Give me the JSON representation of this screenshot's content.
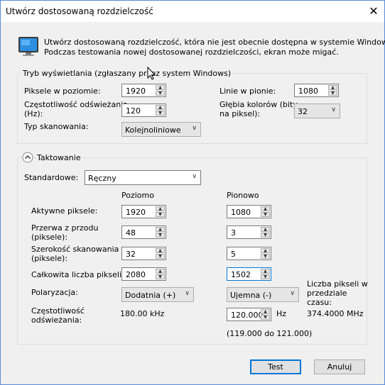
{
  "dialog": {
    "title": "Utwórz dostosowaną rozdzielczość",
    "close_glyph": "✕",
    "description_line1": "Utwórz dostosowaną rozdzielczość, która nie jest obecnie dostępna w systemie Windows.",
    "description_line2": "Podczas testowania nowej dostosowanej rozdzielczości, ekran może migać."
  },
  "display_mode": {
    "legend": "Tryb wyświetlania (zgłaszany przez system Windows)",
    "h_pixels_label": "Piksele w poziomie:",
    "h_pixels_value": "1920",
    "refresh_label_1": "Częstotliwość odświeżania",
    "refresh_label_2": "(Hz):",
    "refresh_value": "120",
    "scan_type_label": "Typ skanowania:",
    "scan_type_value": "Kolejnoliniowe",
    "v_lines_label": "Linie w pionie:",
    "v_lines_value": "1080",
    "color_depth_label_1": "Głębia kolorów (bity",
    "color_depth_label_2": "na piksel):",
    "color_depth_value": "32"
  },
  "timing": {
    "section_label": "Taktowanie",
    "standard_label": "Standardowe:",
    "standard_value": "Ręczny",
    "col_horizontal": "Poziomo",
    "col_vertical": "Pionowo",
    "active_label": "Aktywne piksele:",
    "active_h": "1920",
    "active_v": "1080",
    "front_porch_label_1": "Przerwa z przodu",
    "front_porch_label_2": "(piksele):",
    "front_porch_h": "48",
    "front_porch_v": "3",
    "sync_width_label_1": "Szerokość skanowania",
    "sync_width_label_2": "(piksele):",
    "sync_width_h": "32",
    "sync_width_v": "5",
    "total_label": "Całkowita liczba pikseli:",
    "total_h": "2080",
    "total_v": "1502",
    "polarity_label": "Polaryzacja:",
    "polarity_h": "Dodatnia (+)",
    "polarity_v": "Ujemna (-)",
    "refresh_label_1": "Częstotliwość",
    "refresh_label_2": "odświeżania:",
    "refresh_h": "180.00 kHz",
    "refresh_v": "120.000",
    "refresh_unit": "Hz",
    "refresh_range": "(119.000 do 121.000)",
    "pixel_rate_label_1": "Liczba pikseli w",
    "pixel_rate_label_2": "przedziale",
    "pixel_rate_label_3": "czasu:",
    "pixel_rate_value": "374.4000 MHz"
  },
  "buttons": {
    "test": "Test",
    "cancel": "Anuluj"
  },
  "icons": {
    "monitor": "monitor-icon",
    "collapse": "chevron-up-icon"
  }
}
